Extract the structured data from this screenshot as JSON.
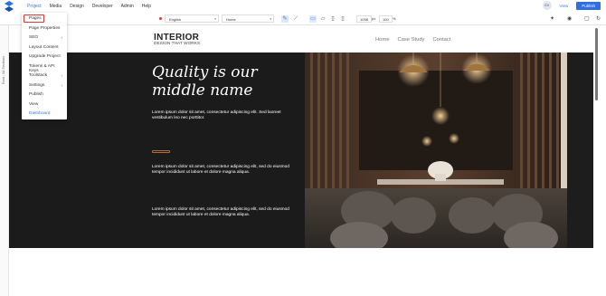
{
  "menubar": {
    "items": [
      "Project",
      "Media",
      "Design",
      "Developer",
      "Admin",
      "Help"
    ],
    "avatar_text": "GV",
    "view_label": "View",
    "publish_label": "Publish"
  },
  "toolbar": {
    "language": "English",
    "page": "Home",
    "width_value": "1098",
    "x_label": "px",
    "zoom_value": "100",
    "zoom_unit": "%"
  },
  "rail": {
    "label": "Root - All Sections"
  },
  "dropdown": {
    "items": [
      {
        "label": "Pages",
        "submenu": false
      },
      {
        "label": "Page Properties",
        "submenu": false
      },
      {
        "label": "SEO",
        "submenu": true
      },
      {
        "label": "Layout Content",
        "submenu": false
      },
      {
        "label": "Upgrade Project",
        "submenu": false
      },
      {
        "label": "Tokens & API Keys",
        "submenu": false
      },
      {
        "label": "Toolstack",
        "submenu": true
      },
      {
        "label": "Settings",
        "submenu": true
      },
      {
        "label": "Publish",
        "submenu": false
      },
      {
        "label": "View",
        "submenu": false
      },
      {
        "label": "Dashboard",
        "submenu": false
      }
    ]
  },
  "site": {
    "brand": "INTERIOR",
    "tagline": "DESIGN THAT WORKS",
    "nav": [
      "Home",
      "Case Study",
      "Contact"
    ],
    "headline_line1": "Quality is our",
    "headline_line2": "middle name",
    "para1": "Lorem ipsum dolor sit amet, consectetur adipiscing elit. Sed laoreet vestibulum leo nec porttitor.",
    "para2": "Lorem ipsum dolor sit amet, consectetur adipiscing elit, sed do eiusmod tempor incididunt ut labore et dolore magna aliqua.",
    "para3": "Lorem ipsum dolor sit amet, consectetur adipiscing elit, sed do eiusmod tempor incididunt ut labore et dolore magna aliqua."
  },
  "colors": {
    "accent": "#2f6fe4",
    "highlight": "#d43b3b",
    "hero_bg": "#1b1b1b"
  }
}
